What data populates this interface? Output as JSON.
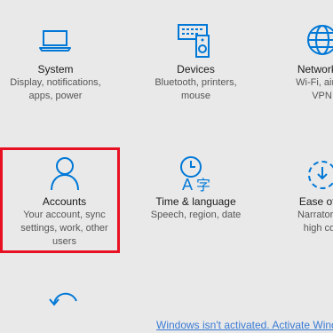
{
  "tiles": {
    "system": {
      "title": "System",
      "desc_lines": [
        "Display, notifications,",
        "apps, power"
      ],
      "icon": "laptop-icon"
    },
    "devices": {
      "title": "Devices",
      "desc_lines": [
        "Bluetooth, printers,",
        "mouse"
      ],
      "icon": "devices-icon"
    },
    "network": {
      "title": "Network &",
      "desc_lines": [
        "Wi-Fi, airpla",
        "VPN"
      ],
      "icon": "globe-icon"
    },
    "accounts": {
      "title": "Accounts",
      "desc_lines": [
        "Your account, sync",
        "settings, work, other",
        "users"
      ],
      "icon": "person-icon"
    },
    "time": {
      "title": "Time & language",
      "desc_lines": [
        "Speech, region, date"
      ],
      "icon": "time-language-icon"
    },
    "ease": {
      "title": "Ease of A",
      "desc_lines": [
        "Narrator, m",
        "high con"
      ],
      "icon": "ease-of-access-icon"
    },
    "update": {
      "icon": "refresh-icon"
    }
  },
  "activation_notice": "Windows isn't activated. Activate Windo",
  "colors": {
    "accent": "#0078d7",
    "highlight": "#e81123",
    "background": "#e9e9e9",
    "link": "#3a7bd5"
  }
}
